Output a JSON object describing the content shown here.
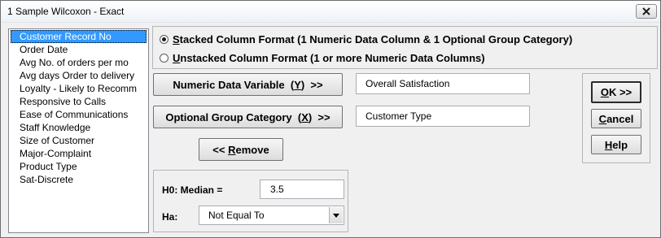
{
  "window": {
    "title": "1 Sample Wilcoxon - Exact"
  },
  "variables": {
    "items": [
      "Customer Record No",
      "Order Date",
      "Avg No. of orders per mo",
      "Avg days Order to delivery",
      "Loyalty - Likely to Recomm",
      "Responsive to Calls",
      "Ease of Communications",
      "Staff Knowledge",
      "Size of Customer",
      "Major-Complaint",
      "Product Type",
      "Sat-Discrete"
    ],
    "selected_index": 0
  },
  "format": {
    "stacked": {
      "accel": "S",
      "rest": "tacked Column Format (1 Numeric Data Column & 1 Optional Group Category)",
      "checked": true
    },
    "unstacked": {
      "accel": "U",
      "rest": "nstacked Column Format (1 or more Numeric Data Columns)",
      "checked": false
    }
  },
  "numeric": {
    "button_pre": "Numeric Data Variable  (",
    "button_accel": "Y",
    "button_post": ")  >>",
    "value": "Overall Satisfaction"
  },
  "group_category": {
    "button_pre": "Optional Group Category  (",
    "button_accel": "X",
    "button_post": ")  >>",
    "value": "Customer Type"
  },
  "remove": {
    "pre": "<< ",
    "accel": "R",
    "rest": "emove"
  },
  "actions": {
    "ok_accel": "O",
    "ok_rest": "K >>",
    "cancel_accel": "C",
    "cancel_rest": "ancel",
    "help_accel": "H",
    "help_rest": "elp"
  },
  "hypothesis": {
    "h0_label": "H0: Median =",
    "h0_value": "3.5",
    "ha_label": "Ha:",
    "ha_value": "Not Equal To"
  }
}
